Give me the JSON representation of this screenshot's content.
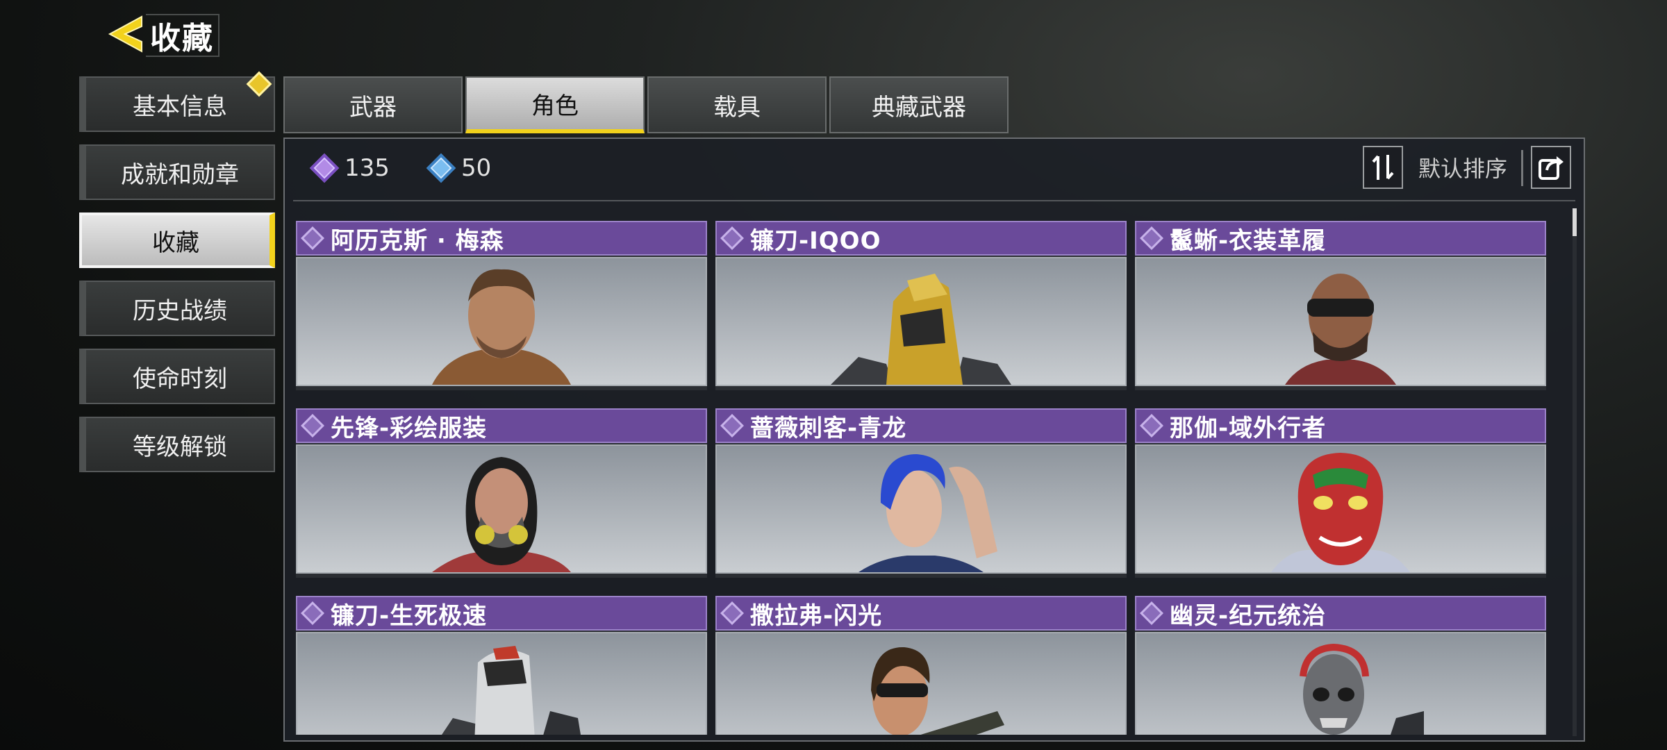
{
  "header": {
    "title": "收藏"
  },
  "sidebar": {
    "items": [
      {
        "label": "基本信息"
      },
      {
        "label": "成就和勋章"
      },
      {
        "label": "收藏"
      },
      {
        "label": "历史战绩"
      },
      {
        "label": "使命时刻"
      },
      {
        "label": "等级解锁"
      }
    ],
    "active_index": 2
  },
  "tabs": [
    {
      "label": "武器"
    },
    {
      "label": "角色"
    },
    {
      "label": "载具"
    },
    {
      "label": "典藏武器"
    }
  ],
  "active_tab": 1,
  "currencies": [
    {
      "icon": "purple-gem-icon",
      "value": "135"
    },
    {
      "icon": "blue-gem-icon",
      "value": "50"
    }
  ],
  "sort": {
    "label": "默认排序"
  },
  "cards": [
    {
      "title": "阿历克斯 · 梅森"
    },
    {
      "title": "镰刀-IQOO"
    },
    {
      "title": "鬣蜥-衣装革履"
    },
    {
      "title": "先锋-彩绘服装"
    },
    {
      "title": "蔷薇刺客-青龙"
    },
    {
      "title": "那伽-域外行者"
    },
    {
      "title": "镰刀-生死极速"
    },
    {
      "title": "撒拉弗-闪光"
    },
    {
      "title": "幽灵-纪元统治"
    }
  ],
  "colors": {
    "accent": "#f2d21c",
    "card_header": "#6a4a9a"
  }
}
